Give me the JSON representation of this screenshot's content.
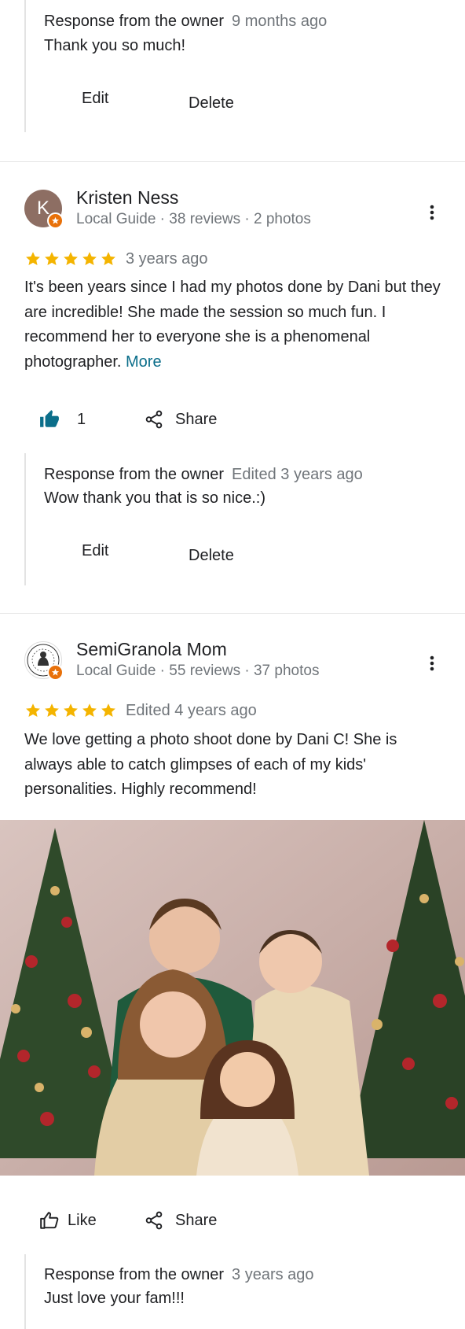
{
  "review0": {
    "owner_label": "Response from the owner",
    "owner_time": "9 months ago",
    "owner_text": "Thank you so much!",
    "edit_label": "Edit",
    "delete_label": "Delete"
  },
  "review1": {
    "avatar_letter": "K",
    "name": "Kristen Ness",
    "meta": "Local Guide · 38 reviews · 2 photos",
    "rating": 5,
    "date": "3 years ago",
    "text": "It's been years since I had my photos done by Dani but they are incredible! She made the session so much fun. I recommend her to everyone she is a phenomenal photographer.",
    "more_label": "More",
    "like_count": "1",
    "share_label": "Share",
    "owner_label": "Response from the owner",
    "owner_time": "Edited 3 years ago",
    "owner_text": "Wow thank you that is so nice.:)",
    "edit_label": "Edit",
    "delete_label": "Delete"
  },
  "review2": {
    "name": "SemiGranola Mom",
    "meta": "Local Guide · 55 reviews · 37 photos",
    "rating": 5,
    "date": "Edited 4 years ago",
    "text": "We love getting a photo shoot done by Dani C! She is always able to catch glimpses of each of my kids' personalities. Highly recommend!",
    "like_label": "Like",
    "share_label": "Share",
    "owner_label": "Response from the owner",
    "owner_time": "3 years ago",
    "owner_text": "Just love your fam!!!"
  },
  "colors": {
    "star": "#f4b400",
    "badge": "#e8710a",
    "link": "#0b6e8a",
    "thumb_filled": "#0b6e8a",
    "avatar_k": "#8d6e63"
  },
  "icons": [
    "star-icon",
    "local-guide-badge-icon",
    "more-vert-icon",
    "thumb-up-filled-icon",
    "thumb-up-outline-icon",
    "share-icon"
  ]
}
